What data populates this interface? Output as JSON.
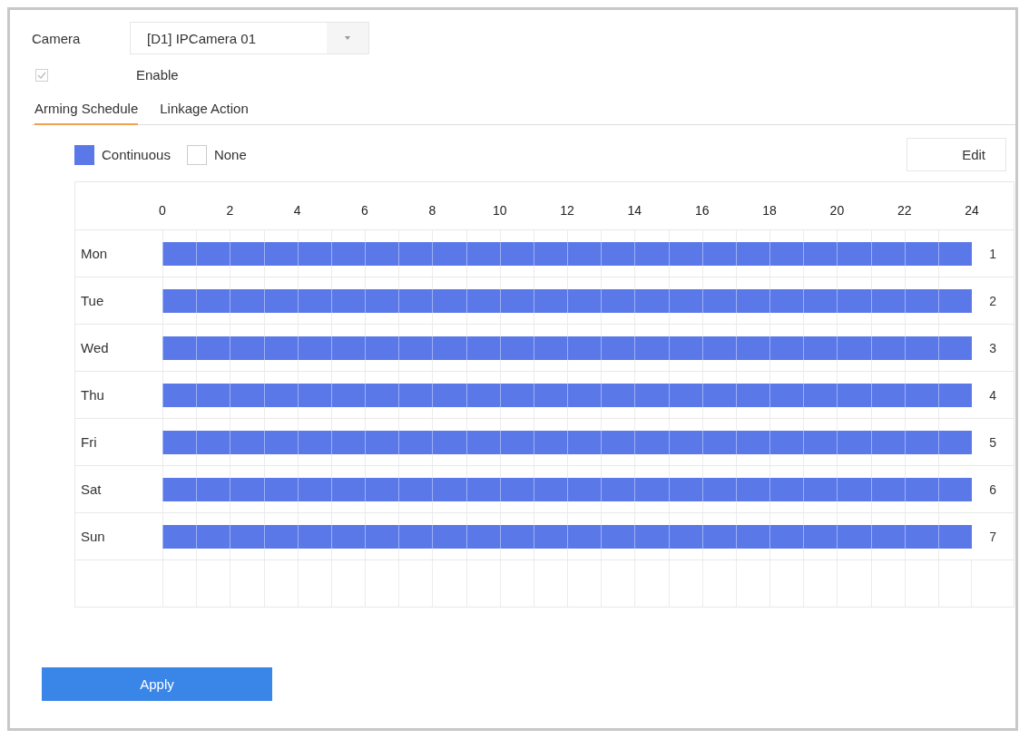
{
  "camera": {
    "label": "Camera",
    "value": "[D1] IPCamera 01"
  },
  "enable": {
    "label": "Enable",
    "checked": true,
    "disabled": true
  },
  "tabs": [
    {
      "label": "Arming Schedule",
      "selected": true
    },
    {
      "label": "Linkage Action",
      "selected": false
    }
  ],
  "legend": [
    {
      "label": "Continuous",
      "kind": "continuous"
    },
    {
      "label": "None",
      "kind": "none"
    }
  ],
  "edit_button": "Edit",
  "schedule": {
    "hours": [
      "0",
      "2",
      "4",
      "6",
      "8",
      "10",
      "12",
      "14",
      "16",
      "18",
      "20",
      "22",
      "24"
    ],
    "days": [
      {
        "day": "Mon",
        "index": "1",
        "kind": "continuous"
      },
      {
        "day": "Tue",
        "index": "2",
        "kind": "continuous"
      },
      {
        "day": "Wed",
        "index": "3",
        "kind": "continuous"
      },
      {
        "day": "Thu",
        "index": "4",
        "kind": "continuous"
      },
      {
        "day": "Fri",
        "index": "5",
        "kind": "continuous"
      },
      {
        "day": "Sat",
        "index": "6",
        "kind": "continuous"
      },
      {
        "day": "Sun",
        "index": "7",
        "kind": "continuous"
      }
    ]
  },
  "apply_button": "Apply"
}
